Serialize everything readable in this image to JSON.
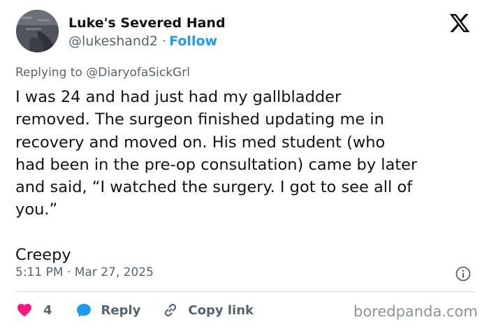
{
  "author": {
    "display_name": "Luke's Severed Hand",
    "handle": "@lukeshand2",
    "separator": "·",
    "follow_label": "Follow"
  },
  "logo": {
    "name": "x-logo",
    "color": "#0f1419"
  },
  "reply_context": {
    "prefix": "Replying to",
    "mention": "@DiaryofaSickGrl"
  },
  "tweet": {
    "paragraph_1": "I was 24 and had just had my gallbladder\nremoved. The surgeon finished updating me in\nrecovery and moved on. His med student (who\nhad been in the pre-op consultation) came by later\nand said, “I watched the surgery. I got to see all of\nyou.”",
    "paragraph_2": "Creepy"
  },
  "timestamp": "5:11 PM · Mar 27, 2025",
  "actions": {
    "like_count": "4",
    "reply_label": "Reply",
    "copy_link_label": "Copy link"
  },
  "colors": {
    "accent": "#1d9bf0",
    "like": "#f91880",
    "text_primary": "#0f1419",
    "text_secondary": "#536471",
    "divider": "#cfd9de"
  },
  "icons": [
    "x-logo",
    "info-icon",
    "heart-icon",
    "reply-bubble-icon",
    "link-icon"
  ],
  "watermark": "boredpanda.com"
}
